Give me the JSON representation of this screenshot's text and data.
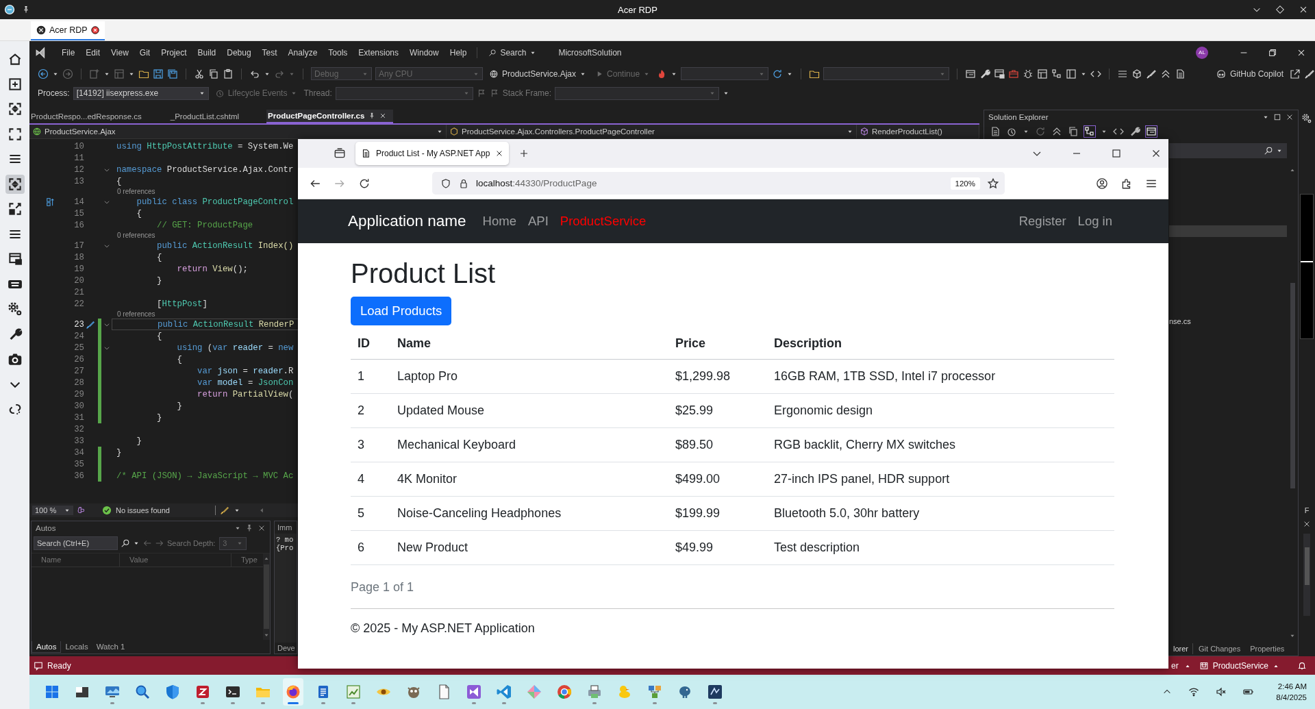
{
  "rdp": {
    "title": "Acer RDP",
    "tab": {
      "label": "Acer RDP",
      "selected": true
    },
    "sidebar": [
      {
        "kind": "home",
        "selected": false
      },
      {
        "kind": "add",
        "selected": false
      },
      {
        "kind": "fit",
        "selected": false
      },
      {
        "kind": "full",
        "selected": false
      },
      {
        "kind": "menu",
        "selected": false
      },
      {
        "kind": "fit",
        "selected": true
      },
      {
        "kind": "expand",
        "selected": false
      },
      {
        "kind": "menu",
        "selected": false
      },
      {
        "kind": "window",
        "selected": false
      },
      {
        "kind": "keyboard",
        "selected": false
      },
      {
        "kind": "gear",
        "selected": false
      },
      {
        "kind": "wrench",
        "selected": false
      },
      {
        "kind": "camera",
        "selected": false
      },
      {
        "kind": "collapse",
        "selected": false
      },
      {
        "kind": "disconnect",
        "selected": false
      }
    ]
  },
  "vs": {
    "menu": [
      "File",
      "Edit",
      "View",
      "Git",
      "Project",
      "Build",
      "Debug",
      "Test",
      "Analyze",
      "Tools",
      "Extensions",
      "Window",
      "Help"
    ],
    "search": "Search",
    "solution": "MicrosoftSolution",
    "account": "AL",
    "config": {
      "label": "Debug",
      "disabled": true
    },
    "platform": {
      "label": "Any CPU",
      "disabled": true
    },
    "startup": "ProductService.Ajax",
    "continue": {
      "label": "Continue",
      "disabled": true
    },
    "copilot": "GitHub Copilot",
    "debug_bar": {
      "process_label": "Process:",
      "process": "[14192] iisexpress.exe",
      "lifecycle": {
        "label": "Lifecycle Events",
        "disabled": true
      },
      "thread_label": "Thread:",
      "stack_label": "Stack Frame:"
    },
    "doc_tabs": [
      {
        "label": "ProductRespo...edResponse.cs",
        "selected": false
      },
      {
        "label": "_ProductList.cshtml",
        "selected": false
      },
      {
        "label": "ProductPageController.cs",
        "selected": true
      }
    ],
    "nav": {
      "project": "ProductService.Ajax",
      "type": "ProductService.Ajax.Controllers.ProductPageController",
      "member": "RenderProductList()"
    },
    "code": [
      {
        "number": "10",
        "kind": "plain",
        "changed": false,
        "current": false,
        "tokens": [
          {
            "kind": "kw",
            "text": "using "
          },
          {
            "kind": "type",
            "text": "HttpPostAttribute"
          },
          {
            "kind": "id",
            "text": " = System.We"
          }
        ]
      },
      {
        "number": "11",
        "kind": "plain",
        "changed": false,
        "current": false
      },
      {
        "number": "12",
        "kind": "plain",
        "changed": false,
        "current": false,
        "expanded": true,
        "tokens": [
          {
            "kind": "kw",
            "text": "namespace "
          },
          {
            "kind": "id",
            "text": "ProductService.Ajax.Contr"
          }
        ]
      },
      {
        "number": "13",
        "kind": "plain",
        "changed": false,
        "current": false,
        "tokens": [
          {
            "kind": "id",
            "text": "{"
          }
        ]
      },
      {
        "number": "14",
        "kind": "override",
        "changed": false,
        "current": false,
        "expanded": true,
        "lens": "0 references",
        "tokens": [
          {
            "kind": "kw",
            "text": "    public class "
          },
          {
            "kind": "type",
            "text": "ProductPageControl"
          }
        ]
      },
      {
        "number": "15",
        "kind": "plain",
        "changed": false,
        "current": false,
        "tokens": [
          {
            "kind": "id",
            "text": "    {"
          }
        ]
      },
      {
        "number": "16",
        "kind": "plain",
        "changed": false,
        "current": false,
        "tokens": [
          {
            "kind": "cmt",
            "text": "        // GET: ProductPage"
          }
        ]
      },
      {
        "number": "17",
        "kind": "plain",
        "changed": false,
        "current": false,
        "expanded": true,
        "lens": "0 references",
        "tokens": [
          {
            "kind": "kw",
            "text": "        public "
          },
          {
            "kind": "type",
            "text": "ActionResult "
          },
          {
            "kind": "fn",
            "text": "Index()"
          }
        ]
      },
      {
        "number": "18",
        "kind": "plain",
        "changed": false,
        "current": false,
        "tokens": [
          {
            "kind": "id",
            "text": "        {"
          }
        ]
      },
      {
        "number": "19",
        "kind": "plain",
        "changed": false,
        "current": false,
        "tokens": [
          {
            "kind": "ctrl",
            "text": "            return "
          },
          {
            "kind": "fn",
            "text": "View"
          },
          {
            "kind": "id",
            "text": "();"
          }
        ]
      },
      {
        "number": "20",
        "kind": "plain",
        "changed": false,
        "current": false,
        "tokens": [
          {
            "kind": "id",
            "text": "        }"
          }
        ]
      },
      {
        "number": "21",
        "kind": "plain",
        "changed": false,
        "current": false
      },
      {
        "number": "22",
        "kind": "plain",
        "changed": false,
        "current": false,
        "tokens": [
          {
            "kind": "id",
            "text": "        ["
          },
          {
            "kind": "type",
            "text": "HttpPost"
          },
          {
            "kind": "id",
            "text": "]"
          }
        ]
      },
      {
        "number": "23",
        "kind": "edit",
        "changed": true,
        "current": true,
        "expanded": true,
        "lens": "0 references",
        "tokens": [
          {
            "kind": "kw",
            "text": "        public "
          },
          {
            "kind": "type",
            "text": "ActionResult "
          },
          {
            "kind": "fn",
            "text": "RenderP"
          }
        ]
      },
      {
        "number": "24",
        "kind": "plain",
        "changed": true,
        "current": false,
        "tokens": [
          {
            "kind": "id",
            "text": "        {"
          }
        ]
      },
      {
        "number": "25",
        "kind": "plain",
        "changed": true,
        "current": false,
        "expanded": true,
        "tokens": [
          {
            "kind": "kw",
            "text": "            using "
          },
          {
            "kind": "id",
            "text": "("
          },
          {
            "kind": "kw",
            "text": "var "
          },
          {
            "kind": "var",
            "text": "reader"
          },
          {
            "kind": "id",
            "text": " = "
          },
          {
            "kind": "kw",
            "text": "new"
          }
        ]
      },
      {
        "number": "26",
        "kind": "plain",
        "changed": true,
        "current": false,
        "tokens": [
          {
            "kind": "id",
            "text": "            {"
          }
        ]
      },
      {
        "number": "27",
        "kind": "plain",
        "changed": true,
        "current": false,
        "tokens": [
          {
            "kind": "kw",
            "text": "                var "
          },
          {
            "kind": "var",
            "text": "json"
          },
          {
            "kind": "id",
            "text": " = "
          },
          {
            "kind": "var",
            "text": "reader"
          },
          {
            "kind": "id",
            "text": ".R"
          }
        ]
      },
      {
        "number": "28",
        "kind": "plain",
        "changed": true,
        "current": false,
        "tokens": [
          {
            "kind": "kw",
            "text": "                var "
          },
          {
            "kind": "var",
            "text": "model"
          },
          {
            "kind": "id",
            "text": " = "
          },
          {
            "kind": "type",
            "text": "JsonCon"
          }
        ]
      },
      {
        "number": "29",
        "kind": "plain",
        "changed": true,
        "current": false,
        "tokens": [
          {
            "kind": "ctrl",
            "text": "                return "
          },
          {
            "kind": "fn",
            "text": "PartialView"
          },
          {
            "kind": "id",
            "text": "("
          }
        ]
      },
      {
        "number": "30",
        "kind": "plain",
        "changed": true,
        "current": false,
        "tokens": [
          {
            "kind": "id",
            "text": "            }"
          }
        ]
      },
      {
        "number": "31",
        "kind": "plain",
        "changed": true,
        "current": false,
        "tokens": [
          {
            "kind": "id",
            "text": "        }"
          }
        ]
      },
      {
        "number": "32",
        "kind": "plain",
        "changed": false,
        "current": false
      },
      {
        "number": "33",
        "kind": "plain",
        "changed": false,
        "current": false,
        "tokens": [
          {
            "kind": "id",
            "text": "    }"
          }
        ]
      },
      {
        "number": "34",
        "kind": "plain",
        "changed": true,
        "current": false,
        "tokens": [
          {
            "kind": "id",
            "text": "}"
          }
        ]
      },
      {
        "number": "35",
        "kind": "plain",
        "changed": true,
        "current": false
      },
      {
        "number": "36",
        "kind": "plain",
        "changed": true,
        "current": false,
        "tokens": [
          {
            "kind": "cmt",
            "text": "/* API (JSON) → JavaScript → MVC Ac"
          }
        ]
      }
    ],
    "editor_status": {
      "zoom": "100 %",
      "issues": "No issues found"
    },
    "autos": {
      "title": "Autos",
      "search_placeholder": "Search (Ctrl+E)",
      "depth_label": "Search Depth:",
      "depth": "3",
      "columns": [
        "Name",
        "Value",
        "Type"
      ],
      "tabs": [
        {
          "label": "Autos",
          "selected": true
        },
        {
          "label": "Locals",
          "selected": false
        },
        {
          "label": "Watch 1",
          "selected": false
        }
      ]
    },
    "immediate": {
      "title": "Imm",
      "lines": [
        "? mo",
        "{Pro"
      ],
      "tab": "Deve"
    },
    "solution_explorer": {
      "title": "Solution Explorer",
      "item": "nse.cs",
      "tabs": [
        {
          "label": "lorer",
          "selected": true
        },
        {
          "label": "Git Changes",
          "selected": false
        },
        {
          "label": "Properties",
          "selected": false
        }
      ]
    },
    "right_strip": {
      "letter": "F"
    },
    "status": {
      "text": "Ready",
      "fragment": "er",
      "branch": "ProductService"
    }
  },
  "taskbar": {
    "apps": [
      {
        "kind": "start",
        "running": false,
        "active": false
      },
      {
        "kind": "desktop",
        "running": false,
        "active": false
      },
      {
        "kind": "remote",
        "running": true,
        "active": false
      },
      {
        "kind": "magnifier",
        "running": false,
        "active": false
      },
      {
        "kind": "shield",
        "running": false,
        "active": false
      },
      {
        "kind": "ftp",
        "running": true,
        "active": false
      },
      {
        "kind": "terminal",
        "running": true,
        "active": false
      },
      {
        "kind": "files",
        "running": true,
        "active": false
      },
      {
        "kind": "firefox",
        "running": true,
        "active": true
      },
      {
        "kind": "notepad",
        "running": true,
        "active": false
      },
      {
        "kind": "sheet",
        "running": true,
        "active": false
      },
      {
        "kind": "eye",
        "running": false,
        "active": false
      },
      {
        "kind": "paint",
        "running": false,
        "active": false
      },
      {
        "kind": "document",
        "running": false,
        "active": false
      },
      {
        "kind": "vs",
        "running": true,
        "active": false
      },
      {
        "kind": "vscode",
        "running": true,
        "active": false
      },
      {
        "kind": "diamond",
        "running": false,
        "active": false
      },
      {
        "kind": "chrome",
        "running": false,
        "active": false
      },
      {
        "kind": "printer",
        "running": true,
        "active": false
      },
      {
        "kind": "duck",
        "running": false,
        "active": false
      },
      {
        "kind": "network",
        "running": true,
        "active": false
      },
      {
        "kind": "elephant",
        "running": false,
        "active": false
      },
      {
        "kind": "vsdark",
        "running": true,
        "active": false
      }
    ],
    "time": "2:46 AM",
    "date": "8/4/2025"
  },
  "browser": {
    "tab": "Product List - My ASP.NET App",
    "url": {
      "host": "localhost",
      "rest": ":44330/ProductPage"
    },
    "zoom": "120%",
    "page": {
      "brand": "Application name",
      "nav": [
        {
          "label": "Home",
          "selected": false
        },
        {
          "label": "API",
          "selected": false
        },
        {
          "label": "ProductService",
          "selected": true
        }
      ],
      "account": [
        "Register",
        "Log in"
      ],
      "heading": "Product List",
      "button": "Load Products",
      "columns": [
        "ID",
        "Name",
        "Price",
        "Description"
      ],
      "rows": [
        [
          "1",
          "Laptop Pro",
          "$1,299.98",
          "16GB RAM, 1TB SSD, Intel i7 processor"
        ],
        [
          "2",
          "Updated Mouse",
          "$25.99",
          "Ergonomic design"
        ],
        [
          "3",
          "Mechanical Keyboard",
          "$89.50",
          "RGB backlit, Cherry MX switches"
        ],
        [
          "4",
          "4K Monitor",
          "$499.00",
          "27-inch IPS panel, HDR support"
        ],
        [
          "5",
          "Noise-Canceling Headphones",
          "$199.99",
          "Bluetooth 5.0, 30hr battery"
        ],
        [
          "6",
          "New Product",
          "$49.99",
          "Test description"
        ]
      ],
      "pager": "Page 1 of 1",
      "footer": "© 2025 - My ASP.NET Application"
    }
  }
}
